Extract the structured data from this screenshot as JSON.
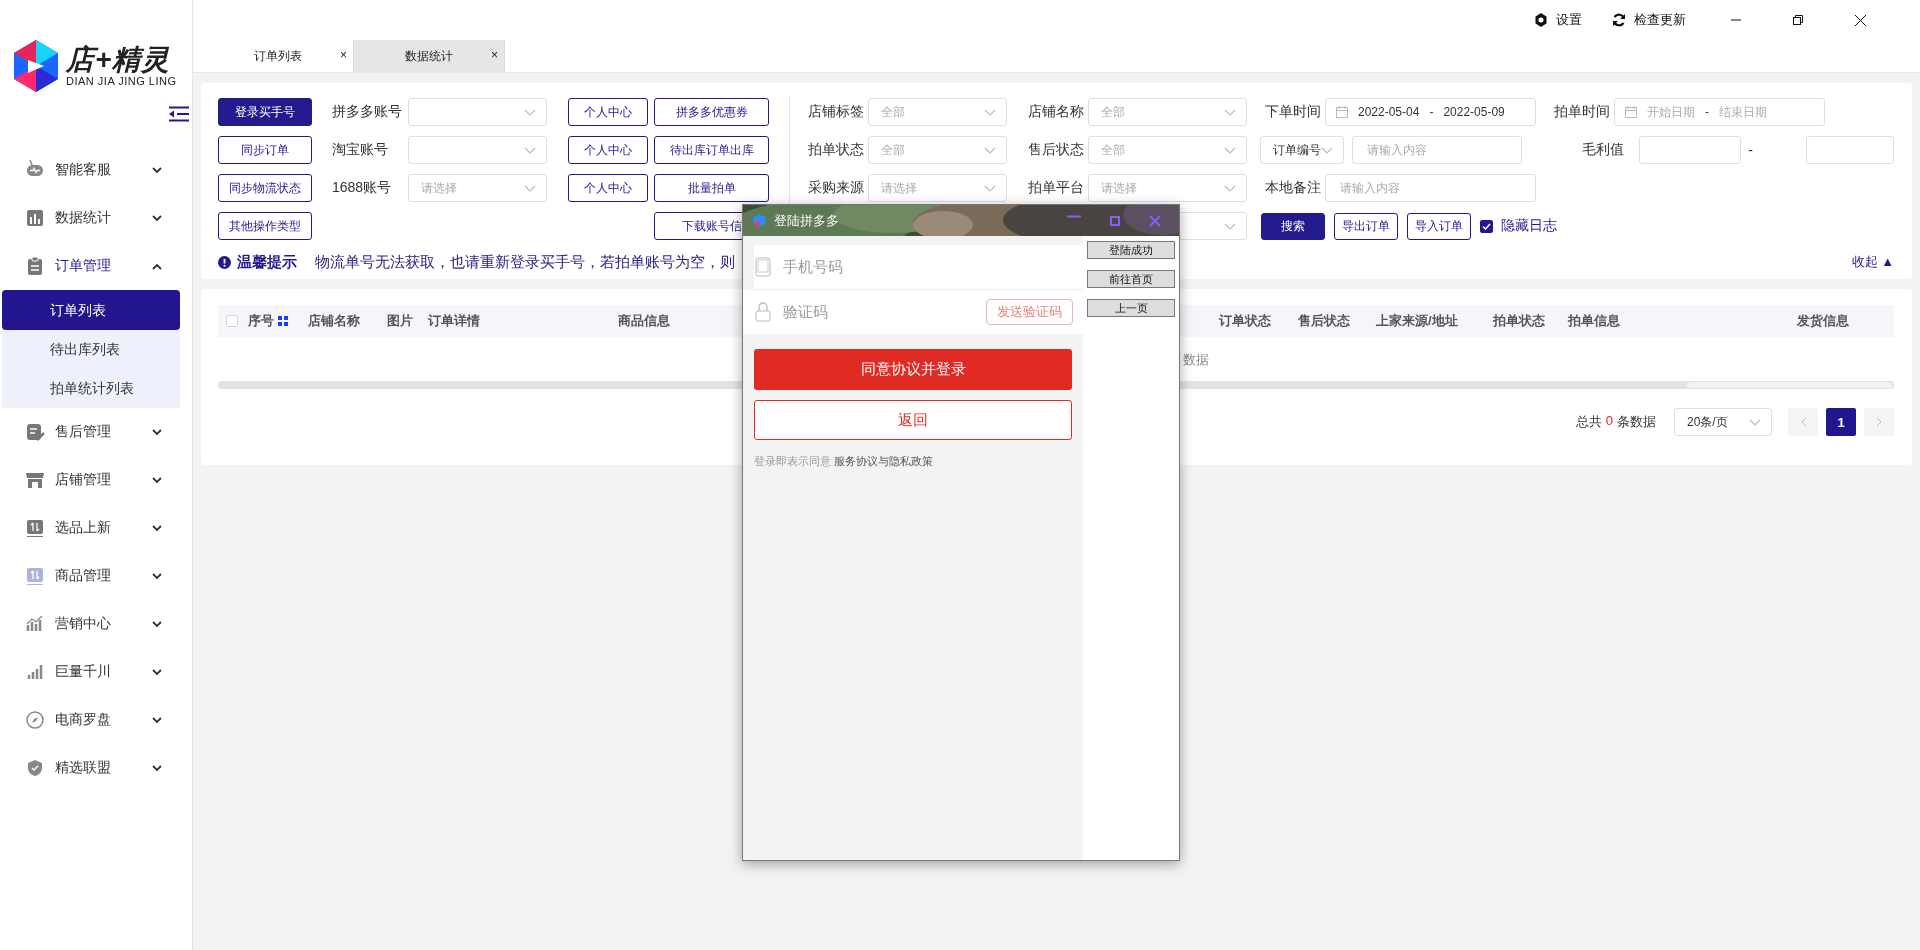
{
  "app_bar": {
    "logo": {
      "title": "店+精灵",
      "subtitle": "DIAN JIA JING LING"
    },
    "actions": [
      {
        "label": "设置"
      },
      {
        "label": "检查更新"
      }
    ]
  },
  "sidebar": {
    "items": [
      {
        "label": "智能客服",
        "expanded": false
      },
      {
        "label": "数据统计",
        "expanded": false
      },
      {
        "label": "订单管理",
        "expanded": true,
        "children": [
          {
            "label": "订单列表",
            "selected": true
          },
          {
            "label": "待出库列表",
            "selected": false
          },
          {
            "label": "拍单统计列表",
            "selected": false
          }
        ]
      },
      {
        "label": "售后管理",
        "expanded": false
      },
      {
        "label": "店铺管理",
        "expanded": false
      },
      {
        "label": "选品上新",
        "expanded": false
      },
      {
        "label": "商品管理",
        "expanded": false
      },
      {
        "label": "营销中心",
        "expanded": false
      },
      {
        "label": "巨量千川",
        "expanded": false
      },
      {
        "label": "电商罗盘",
        "expanded": false
      },
      {
        "label": "精选联盟",
        "expanded": false
      }
    ]
  },
  "tabs": [
    {
      "label": "订单列表",
      "selected": true,
      "close": "×"
    },
    {
      "label": "数据统计",
      "selected": false,
      "close": "×"
    }
  ],
  "account_rows": [
    {
      "button": {
        "label": "登录买手号",
        "primary": true
      },
      "label": "拼多多账号",
      "select": {},
      "center_button": "个人中心",
      "right_button": "拼多多优惠券"
    },
    {
      "button": {
        "label": "同步订单",
        "primary": false
      },
      "label": "淘宝账号",
      "select": {},
      "center_button": "个人中心",
      "right_button": "待出库订单出库"
    },
    {
      "button": {
        "label": "同步物流状态",
        "primary": false
      },
      "label": "1688账号",
      "select": {
        "placeholder": "请选择"
      },
      "center_button": "个人中心",
      "right_button": "批量拍单"
    },
    {
      "button": {
        "label": "其他操作类型",
        "primary": false
      },
      "right_button": "下载账号信"
    }
  ],
  "filter_rows": [
    [
      {
        "kind": "select",
        "label": "店铺标签",
        "placeholder": "全部"
      },
      {
        "kind": "select",
        "label": "店铺名称",
        "placeholder": "全部"
      },
      {
        "kind": "date_range",
        "label": "下单时间",
        "start": {
          "value": "2022-05-04"
        },
        "separator": "-",
        "end": {
          "value": "2022-05-09"
        }
      },
      {
        "kind": "date_range",
        "label": "拍单时间",
        "start": {
          "placeholder": "开始日期"
        },
        "separator": "-",
        "end": {
          "placeholder": "结束日期"
        }
      }
    ],
    [
      {
        "kind": "select",
        "label": "拍单状态",
        "placeholder": "全部"
      },
      {
        "kind": "select",
        "label": "售后状态",
        "placeholder": "全部"
      },
      {
        "kind": "keyed_input",
        "key": "订单编号",
        "placeholder": "请输入内容"
      },
      {
        "kind": "number_range",
        "label": "毛利值",
        "separator": "-"
      }
    ],
    [
      {
        "kind": "select",
        "label": "采购来源",
        "placeholder": "请选择"
      },
      {
        "kind": "select",
        "label": "拍单平台",
        "placeholder": "请选择"
      },
      {
        "kind": "input",
        "label": "本地备注",
        "placeholder": "请输入内容"
      }
    ],
    [
      {
        "kind": "select"
      }
    ]
  ],
  "filter_actions": {
    "buttons": [
      {
        "label": "搜索",
        "primary": true
      },
      {
        "label": "导出订单",
        "primary": false
      },
      {
        "label": "导入订单",
        "primary": false
      }
    ],
    "checkbox": {
      "label": "隐藏日志",
      "checked": true
    }
  },
  "notice": {
    "title": "温馨提示",
    "text": "物流单号无法获取，也请重新登录买手号，若拍单账号为空，则",
    "collapse": "收起 ▲"
  },
  "table": {
    "select_all": {
      "checked": false
    },
    "columns": [
      {
        "label": "序号"
      },
      {
        "label": "店铺名称"
      },
      {
        "label": "图片"
      },
      {
        "label": "订单详情"
      },
      {
        "label": "商品信息"
      },
      {
        "label": "订单状态"
      },
      {
        "label": "售后状态"
      },
      {
        "label": "上家来源/地址"
      },
      {
        "label": "拍单状态"
      },
      {
        "label": "拍单信息"
      },
      {
        "label": "发货信息"
      }
    ],
    "empty_text": "数据"
  },
  "pagination": {
    "total_prefix": "总共",
    "total": "0",
    "total_suffix": "条数据",
    "page_size": "20条/页",
    "pages": [
      {
        "label": "1",
        "selected": true
      }
    ]
  },
  "login_dialog": {
    "title": "登陆拼多多",
    "phone": {
      "placeholder": "手机号码"
    },
    "code": {
      "placeholder": "验证码"
    },
    "send_code": {
      "label": "发送验证码",
      "disabled": true
    },
    "submit": "同意协议并登录",
    "back": "返回",
    "agreement": {
      "prefix": "登录即表示同意",
      "link": "服务协议与隐私政策"
    },
    "side_buttons": [
      "登陆成功",
      "前往首页",
      "上一页"
    ]
  }
}
